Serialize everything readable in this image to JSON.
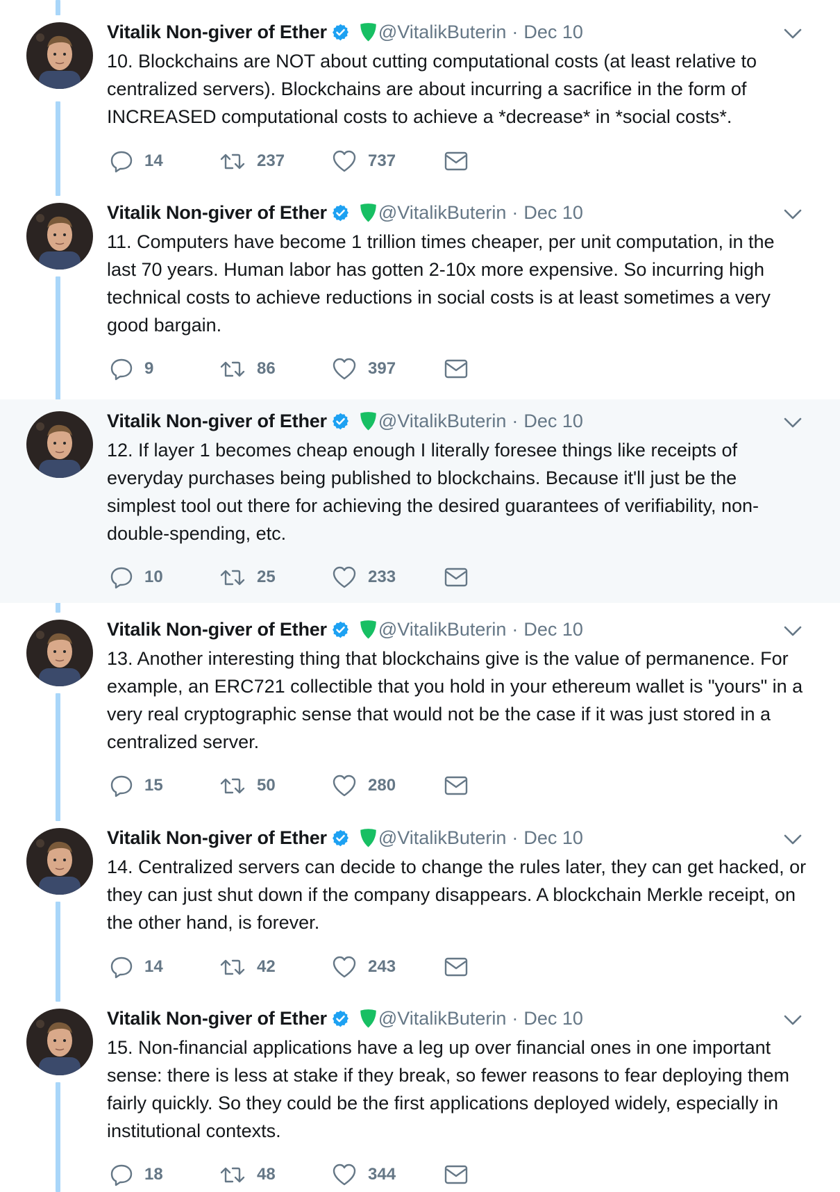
{
  "colors": {
    "thread_line": "#a9d6f9",
    "highlight_bg": "#f5f8fa",
    "secondary_text": "#657786",
    "verified": "#1da1f2",
    "shield": "#17bf63"
  },
  "icons": {
    "verified": "verified-badge-icon",
    "shield": "green-shield-icon",
    "caret": "chevron-down-icon",
    "reply": "reply-icon",
    "retweet": "retweet-icon",
    "like": "heart-icon",
    "dm": "envelope-icon"
  },
  "tweets": [
    {
      "name": "Vitalik Non-giver of Ether",
      "handle": "@VitalikButerin",
      "separator": "·",
      "date": "Dec 10",
      "text": "10. Blockchains are NOT about cutting computational costs (at least relative to centralized servers). Blockchains are about incurring a sacrifice in the form of INCREASED computational costs to achieve a *decrease* in *social costs*.",
      "replies": "14",
      "retweets": "237",
      "likes": "737"
    },
    {
      "name": "Vitalik Non-giver of Ether",
      "handle": "@VitalikButerin",
      "separator": "·",
      "date": "Dec 10",
      "text": "11. Computers have become 1 trillion times cheaper, per unit computation, in the last 70 years. Human labor has gotten 2-10x more expensive. So incurring high technical costs to achieve reductions in social costs is at least sometimes a very good bargain.",
      "replies": "9",
      "retweets": "86",
      "likes": "397"
    },
    {
      "name": "Vitalik Non-giver of Ether",
      "handle": "@VitalikButerin",
      "separator": "·",
      "date": "Dec 10",
      "text": "12. If layer 1 becomes cheap enough I literally foresee things like receipts of everyday purchases being published to blockchains. Because it'll just be the simplest tool out there for achieving the desired guarantees of verifiability, non-double-spending, etc.",
      "replies": "10",
      "retweets": "25",
      "likes": "233"
    },
    {
      "name": "Vitalik Non-giver of Ether",
      "handle": "@VitalikButerin",
      "separator": "·",
      "date": "Dec 10",
      "text": "13. Another interesting thing that blockchains give is the value of permanence. For example, an ERC721 collectible that you hold in your ethereum wallet is \"yours\" in a very real cryptographic sense that would not be the case if it was just stored in a centralized server.",
      "replies": "15",
      "retweets": "50",
      "likes": "280"
    },
    {
      "name": "Vitalik Non-giver of Ether",
      "handle": "@VitalikButerin",
      "separator": "·",
      "date": "Dec 10",
      "text": "14. Centralized servers can decide to change the rules later, they can get hacked, or they can just shut down if the company disappears. A blockchain Merkle receipt, on the other hand, is forever.",
      "replies": "14",
      "retweets": "42",
      "likes": "243"
    },
    {
      "name": "Vitalik Non-giver of Ether",
      "handle": "@VitalikButerin",
      "separator": "·",
      "date": "Dec 10",
      "text": "15. Non-financial applications have a leg up over financial ones in one important sense: there is less at stake if they break, so fewer reasons to fear deploying them fairly quickly. So they could be the first applications deployed widely, especially in institutional contexts.",
      "replies": "18",
      "retweets": "48",
      "likes": "344"
    }
  ]
}
